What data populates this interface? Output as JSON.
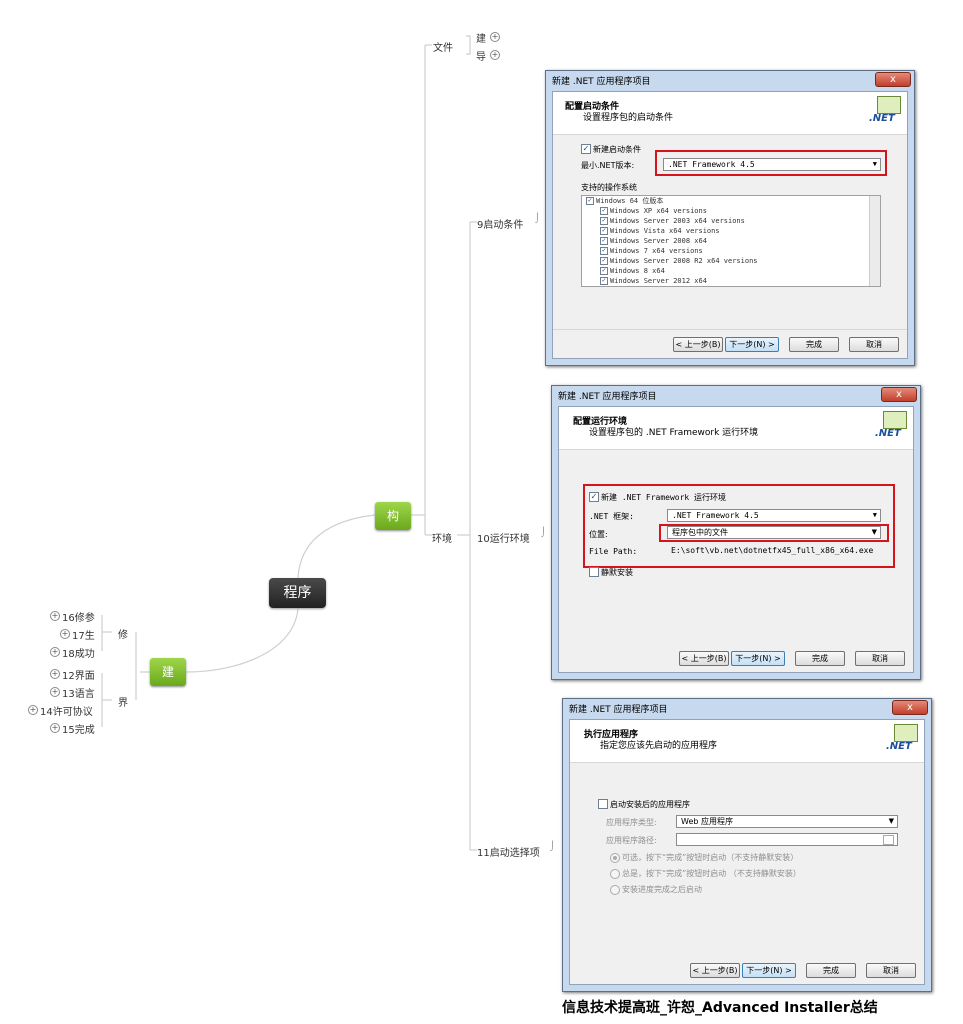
{
  "mindmap": {
    "root": "程序",
    "node_gou": "构",
    "node_jian": "建",
    "wenjian": "文件",
    "wenjian_children": [
      "建",
      "导"
    ],
    "huanjing": "环境",
    "huanjing_children": [
      "9启动条件",
      "10运行环境",
      "11启动选择项"
    ],
    "xiu": "修",
    "xiu_children": [
      "16修参",
      "17生",
      "18成功"
    ],
    "jie": "界",
    "jie_children": [
      "12界面",
      "13语言",
      "14许可协议",
      "15完成"
    ]
  },
  "dialog1": {
    "title": "新建 .NET 应用程序项目",
    "close": "x",
    "header_title": "配置启动条件",
    "header_sub": "设置程序包的启动条件",
    "net_logo": ".NET",
    "new_condition_label": "新建启动条件",
    "min_version_label": "最小.NET版本:",
    "min_version_value": ".NET Framework 4.5",
    "os_label": "支持的操作系统",
    "os_list": [
      "Windows 64 位版本",
      "Windows XP x64 versions",
      "Windows Server 2003 x64 versions",
      "Windows Vista x64 versions",
      "Windows Server 2008 x64",
      "Windows 7 x64 versions",
      "Windows Server 2008 R2 x64 versions",
      "Windows 8 x64",
      "Windows Server 2012 x64"
    ],
    "back": "< 上一步(B)",
    "next": "下一步(N) >",
    "finish": "完成",
    "cancel": "取消"
  },
  "dialog2": {
    "title": "新建 .NET 应用程序项目",
    "close": "x",
    "header_title": "配置运行环境",
    "header_sub": "设置程序包的 .NET Framework 运行环境",
    "net_logo": ".NET",
    "new_runtime_label": "新建 .NET Framework 运行环境",
    "framework_label": ".NET 框架:",
    "framework_value": ".NET Framework 4.5",
    "location_label": "位置:",
    "location_value": "程序包中的文件",
    "filepath_label": "File Path:",
    "filepath_value": "E:\\soft\\vb.net\\dotnetfx45_full_x86_x64.exe",
    "silent_label": "静默安装",
    "back": "< 上一步(B)",
    "next": "下一步(N) >",
    "finish": "完成",
    "cancel": "取消"
  },
  "dialog3": {
    "title": "新建 .NET 应用程序项目",
    "close": "x",
    "header_title": "执行应用程序",
    "header_sub": "指定您应该先启动的应用程序",
    "net_logo": ".NET",
    "launch_label": "启动安装后的应用程序",
    "app_type_label": "应用程序类型:",
    "app_type_value": "Web 应用程序",
    "app_path_label": "应用程序路径:",
    "radio1": "可选，按下“完成”按钮时启动（不支持静默安装）",
    "radio2": "总是，按下“完成”按钮时启动 （不支持静默安装）",
    "radio3": "安装进度完成之后启动",
    "back": "< 上一步(B)",
    "next": "下一步(N) >",
    "finish": "完成",
    "cancel": "取消"
  },
  "caption": "信息技术提高班_许恕_Advanced Installer总结",
  "colors": {
    "accent_green": "#7cbf2a",
    "root_dark": "#333333",
    "highlight_red": "#d6141c"
  }
}
